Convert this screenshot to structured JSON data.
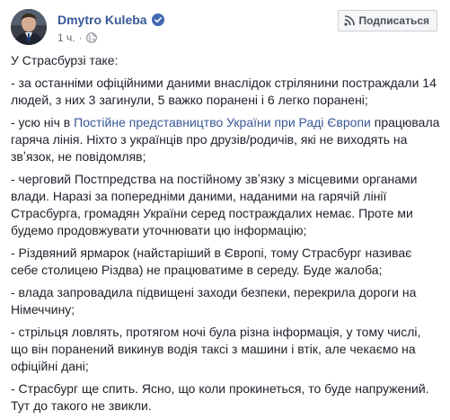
{
  "header": {
    "author_name": "Dmytro Kuleba",
    "time": "1 ч.",
    "subscribe_label": "Подписаться"
  },
  "post": {
    "intro": "У Страсбурзі таке:",
    "p1": "- за останніми офіційними даними внаслідок стрілянини постраждали 14 людей, з них 3 загинули, 5 важко поранені і 6 легко поранені;",
    "p2_prefix": "- усю ніч в ",
    "p2_link": "Постійне представництво України при Раді Європи",
    "p2_suffix": " працювала гаряча лінія. Ніхто з українців про друзів/родичів, які не виходять на звʼязок, не повідомляв;",
    "p3": "- черговий Постпредства на постійному звʼязку з місцевими органами влади. Наразі за попередніми даними, наданими на гарячій лінії Страсбурга, громадян України серед постраждалих немає. Проте ми будемо продовжувати уточнювати цю інформацію;",
    "p4": "- Різдвяний ярмарок (найстаріший в Європі, тому Страсбург називає себе столицею Різдва) не працюватиме в середу. Буде жалоба;",
    "p5": "- влада запровадила підвищені заходи безпеки, перекрила дороги на Німеччину;",
    "p6": "- стрільця ловлять, протягом ночі була різна інформація, у тому числі, що він поранений викинув водія таксі з машини і втік, але чекаємо на офіційні дані;",
    "p7": "- Страсбург ще спить. Ясно, що коли прокинеться, то буде напружений. Тут до такого не звикли."
  },
  "colors": {
    "link": "#385898",
    "verified": "#4267b2",
    "meta": "#616770",
    "text": "#1d2129"
  },
  "icons": {
    "verified": "verified-badge-icon",
    "privacy": "globe-icon",
    "subscribe": "rss-icon"
  }
}
